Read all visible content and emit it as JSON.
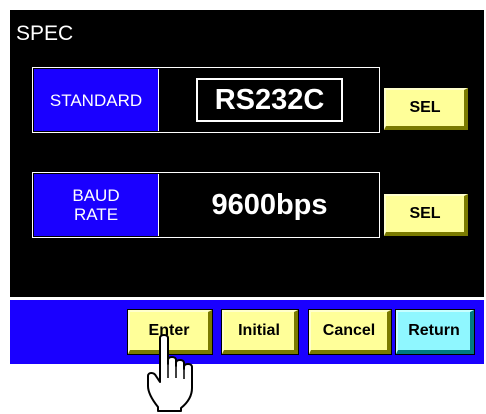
{
  "screen": {
    "title": "SPEC"
  },
  "settings": [
    {
      "label": "STANDARD",
      "value": "RS232C",
      "button": "SEL"
    },
    {
      "label": "BAUD\nRATE",
      "value": "9600bps",
      "button": "SEL"
    }
  ],
  "footer": {
    "enter": "Enter",
    "initial": "Initial",
    "cancel": "Cancel",
    "return": "Return"
  },
  "colors": {
    "panel": "#000000",
    "label_bg": "#1a00ff",
    "button": "#ffff99",
    "return_button": "#8ff7ff"
  },
  "icons": {
    "pointer": "pointing-hand-icon"
  }
}
